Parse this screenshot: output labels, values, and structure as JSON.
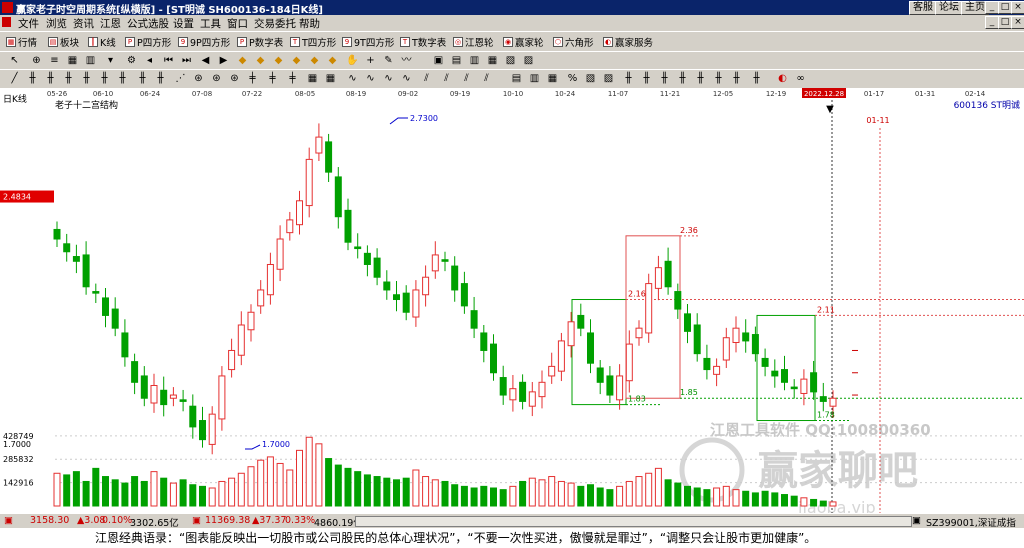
{
  "window": {
    "title": "赢家老子时空周期系统[纵横版] - [ST明诚  SH600136-184日K线]",
    "top_buttons": [
      "客服",
      "论坛",
      "主页"
    ],
    "controls": [
      "_",
      "□",
      "×"
    ]
  },
  "menu": [
    "文件",
    "浏览",
    "资讯",
    "江恩",
    "公式选股",
    "设置",
    "工具",
    "窗口",
    "交易委托",
    "帮助"
  ],
  "doc_controls": [
    "_",
    "□",
    "×"
  ],
  "toolbar1": [
    {
      "label": "行情",
      "icon": "grid-icon"
    },
    {
      "label": "板块",
      "icon": "blocks-icon"
    },
    {
      "label": "K线",
      "icon": "candle-icon"
    },
    {
      "label": "P四方形",
      "icon": "p-square-icon"
    },
    {
      "label": "9P四方形",
      "icon": "9p-square-icon"
    },
    {
      "label": "P数字表",
      "icon": "p-table-icon"
    },
    {
      "label": "T四方形",
      "icon": "t-square-icon"
    },
    {
      "label": "9T四方形",
      "icon": "9t-square-icon"
    },
    {
      "label": "T数字表",
      "icon": "t-table-icon"
    },
    {
      "label": "江恩轮",
      "icon": "gann-wheel-icon"
    },
    {
      "label": "赢家轮",
      "icon": "winner-wheel-icon"
    },
    {
      "label": "六角形",
      "icon": "hexagon-icon"
    },
    {
      "label": "赢家服务",
      "icon": "service-icon"
    }
  ],
  "chart": {
    "period_label": "日K线",
    "structure_label": "老子十二宫结构",
    "symbol": "600136 ST明诚",
    "current_price_tag": "2.4834",
    "date_ticks": [
      "05-26",
      "06-10",
      "06-24",
      "07-08",
      "07-22",
      "08-05",
      "08-19",
      "09-02",
      "09-19",
      "10-10",
      "10-24",
      "11-07",
      "11-21",
      "12-05",
      "12-19",
      "2022.12.28",
      "01-17",
      "01-31",
      "02-14"
    ],
    "highlight_date": "2022.12.28",
    "future_mark": "01-11",
    "annotations": {
      "high": "2.7300",
      "low": "1.7000",
      "a236": "2.36",
      "a216": "2.16",
      "a211": "2.11",
      "a185": "1.85",
      "a183": "1.83",
      "a178": "1.78"
    },
    "price_axis": "1.7000",
    "volume_axis": [
      "428749",
      "285832",
      "142916"
    ],
    "watermark_qq": "江恩工具软件 QQ:100800360",
    "watermark_brand": "赢家聊吧",
    "watermark_url": "jiaoba.vip"
  },
  "status": {
    "sh_index": "3158.30",
    "sh_change": "▲3.08",
    "sh_pct": "0.10%",
    "sh_amount": "3302.65亿",
    "sz_index": "11369.38",
    "sz_change": "▲37.37",
    "sz_pct": "0.33%",
    "sz_amount": "4860.19亿",
    "right_label": "SZ399001,深证成指"
  },
  "quote": "江恩经典语录：“图表能反映出一切股市或公司股民的总体心理状况”，“不要一次性买进，傲慢就是罪过”，“调整只会让股市更加健康”。",
  "colors": {
    "up": "#e53030",
    "down": "#00a000",
    "titlebar": "#0a246a",
    "marker": "#d00000"
  },
  "chart_data": [
    {
      "type": "candlestick",
      "title": "老子十二宫结构",
      "x": [
        "05-26",
        "06-10",
        "06-24",
        "07-08",
        "07-22",
        "08-05",
        "08-19",
        "09-02",
        "09-19",
        "10-10",
        "10-24",
        "11-07",
        "11-21",
        "12-05",
        "12-19",
        "2022.12.28",
        "01-17",
        "01-31",
        "02-14"
      ],
      "ylim": [
        1.6,
        2.8
      ],
      "price_marks": {
        "high": 2.73,
        "low": 1.7,
        "current": 2.4834
      },
      "box_levels": [
        2.36,
        2.16,
        2.11,
        1.85,
        1.83,
        1.78
      ],
      "closes": [
        2.35,
        2.31,
        2.28,
        2.2,
        2.18,
        2.11,
        2.07,
        1.98,
        1.9,
        1.85,
        1.89,
        1.83,
        1.86,
        1.84,
        1.76,
        1.72,
        1.8,
        1.92,
        2.0,
        2.08,
        2.12,
        2.19,
        2.27,
        2.35,
        2.41,
        2.47,
        2.6,
        2.67,
        2.56,
        2.42,
        2.34,
        2.32,
        2.27,
        2.23,
        2.19,
        2.16,
        2.12,
        2.19,
        2.23,
        2.3,
        2.28,
        2.19,
        2.14,
        2.07,
        2.0,
        1.93,
        1.86,
        1.88,
        1.84,
        1.87,
        1.9,
        1.95,
        2.03,
        2.09,
        2.07,
        1.96,
        1.9,
        1.86,
        1.92,
        2.02,
        2.07,
        2.21,
        2.26,
        2.2,
        2.13,
        2.06,
        1.99,
        1.94,
        1.95,
        2.04,
        2.07,
        2.03,
        1.99,
        1.95,
        1.92,
        1.9,
        1.88,
        1.91,
        1.87,
        1.84,
        1.85
      ]
    },
    {
      "type": "bar",
      "title": "",
      "ylim": [
        0,
        550000
      ],
      "ticks": [
        142916,
        285832,
        428749
      ],
      "values": [
        200000,
        190000,
        210000,
        150000,
        230000,
        180000,
        160000,
        140000,
        180000,
        150000,
        210000,
        170000,
        140000,
        160000,
        130000,
        120000,
        110000,
        150000,
        170000,
        200000,
        240000,
        280000,
        300000,
        260000,
        220000,
        340000,
        420000,
        380000,
        290000,
        250000,
        230000,
        210000,
        190000,
        180000,
        170000,
        160000,
        170000,
        220000,
        180000,
        160000,
        150000,
        130000,
        120000,
        110000,
        120000,
        110000,
        100000,
        120000,
        150000,
        170000,
        160000,
        180000,
        150000,
        140000,
        120000,
        130000,
        110000,
        100000,
        120000,
        150000,
        180000,
        200000,
        230000,
        160000,
        140000,
        120000,
        110000,
        100000,
        110000,
        120000,
        100000,
        90000,
        80000,
        90000,
        80000,
        70000,
        60000,
        50000,
        40000,
        30000,
        25000
      ]
    }
  ]
}
